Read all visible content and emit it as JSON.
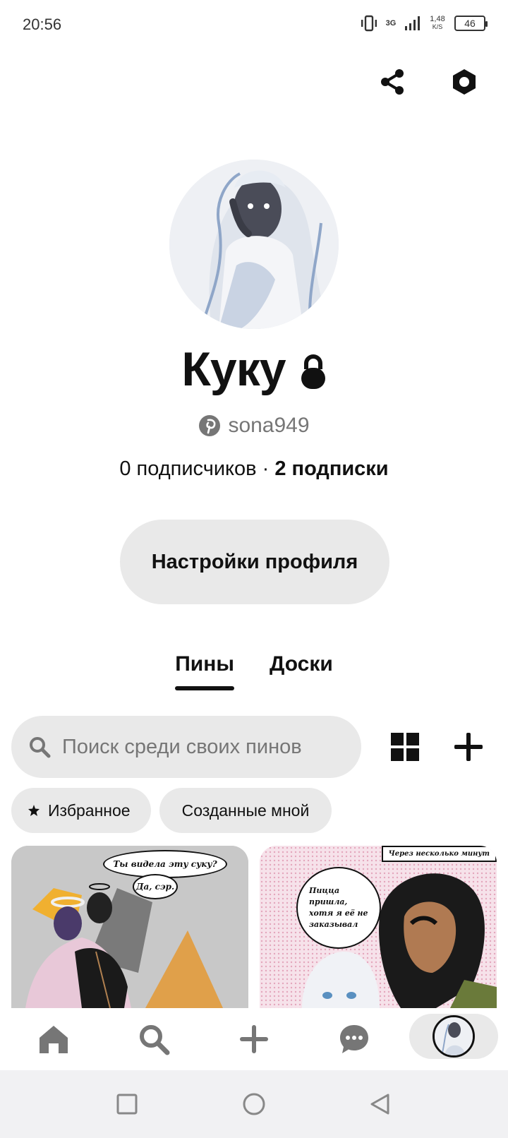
{
  "status_bar": {
    "time": "20:56",
    "network": "3G",
    "speed_value": "1,48",
    "speed_unit": "K/S",
    "battery": "46"
  },
  "top_actions": {
    "share_icon": "share-icon",
    "settings_icon": "settings-hexagon-icon"
  },
  "profile": {
    "name": "Куку",
    "username": "sona949",
    "followers": "0 подписчиков",
    "separator": " · ",
    "following": "2 подписки",
    "edit_button": "Настройки профиля"
  },
  "tabs": [
    {
      "label": "Пины",
      "active": true
    },
    {
      "label": "Доски",
      "active": false
    }
  ],
  "search": {
    "placeholder": "Поиск среди своих пинов"
  },
  "filters": {
    "favorites": "Избранное",
    "created_by_me": "Созданные мной"
  },
  "pins": [
    {
      "bubble_1": "Ты видела эту суку?",
      "bubble_2": "Да, сэр."
    },
    {
      "caption": "Через несколько минут",
      "bubble": "Пицца пришла, хотя я её не заказывал"
    }
  ],
  "bottom_nav": {
    "items": [
      "home-icon",
      "search-icon",
      "plus-icon",
      "messages-icon",
      "profile-avatar"
    ]
  },
  "colors": {
    "chip_bg": "#e9e9e9",
    "muted_text": "#767676",
    "primary_text": "#111111"
  }
}
